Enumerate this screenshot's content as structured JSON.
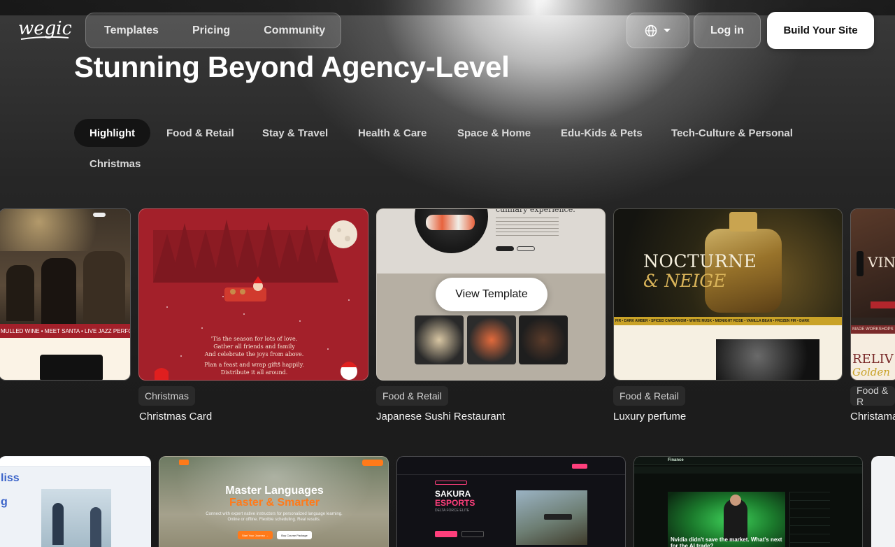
{
  "header": {
    "logo_text": "wegic",
    "nav": [
      "Templates",
      "Pricing",
      "Community"
    ],
    "login_label": "Log in",
    "build_label": "Build Your Site"
  },
  "hero": {
    "title": "Stunning Beyond Agency-Level"
  },
  "tabs": [
    "Highlight",
    "Food & Retail",
    "Stay & Travel",
    "Health & Care",
    "Space & Home",
    "Edu-Kids & Pets",
    "Tech-Culture & Personal",
    "Christmas"
  ],
  "active_tab": "Highlight",
  "cards": [
    {
      "category": "Christmas",
      "title": "Christmas Card"
    },
    {
      "category": "Food & Retail",
      "title": "Japanese Sushi Restaurant"
    },
    {
      "category": "Food & Retail",
      "title": "Luxury perfume"
    },
    {
      "category": "Food & R",
      "title": "Christama"
    }
  ],
  "view_template_label": "View Template",
  "card_texts": {
    "market_ticker": "MULLED WINE  •  MEET SANTA  •  LIVE JAZZ PERFO",
    "christmas_lines": [
      "'Tis the season for lots of love.",
      "Gather all friends and family",
      "And celebrate the joys from above.",
      "Plan a feast and wrap gifts happily.",
      "Distribute it all around."
    ],
    "sushi_heading": "culinary experience.",
    "perfume_title_1": "NOCTURNE",
    "perfume_title_2": "& NEIGE",
    "perfume_ticker": "FIR  •  DARK AMBER  •  SPICED CARDAMOM  •  WHITE MUSK  •  MIDNIGHT ROSE  •  VANILLA BEAN  •  FROZEN FIR  •  DARK",
    "vin_text": "VIN",
    "relive_1": "RELIV",
    "relive_2": "Golden",
    "workshop_text": "MADE WORKSHOPS"
  },
  "row2": {
    "lang_a": "liss",
    "lang_b": "g",
    "languages_title_1": "Master Languages",
    "languages_title_2": "Faster & Smarter",
    "languages_sub": "Connect with expert native instructors for personalized language learning. Online or offline. Flexible scheduling. Real results.",
    "languages_btn_1": "Start Your Journey →",
    "languages_btn_2": "Buy Course Package",
    "esports_title_1": "SAKURA",
    "esports_title_2": "ESPORTS",
    "esports_sub": "DELTA FORCE ELITE",
    "finance_brand": "Finance",
    "finance_headline": "Nvidia didn't save the market. What's next for the AI trade?"
  },
  "colors": {
    "christmas_red": "#a3202a",
    "sushi_bg": "#b6afa3",
    "perfume_ticker": "#c9a227",
    "esports_pink": "#ff3f7c",
    "languages_orange": "#ff7a1a"
  }
}
